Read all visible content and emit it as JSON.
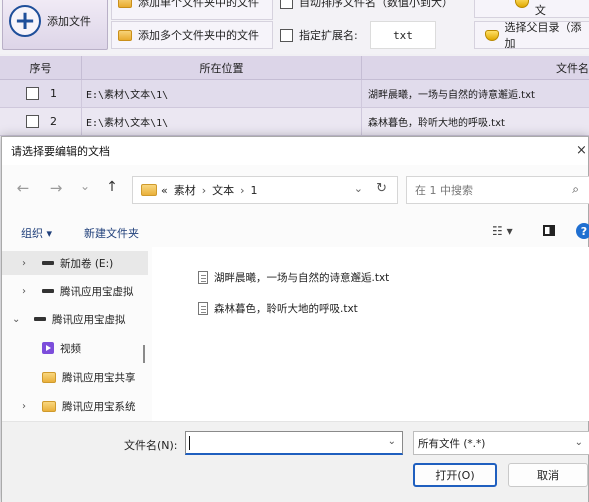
{
  "app": {
    "add_file_label": "添加文件",
    "add_single_folder_label": "添加单个文件夹中的文件",
    "add_multi_folder_label": "添加多个文件夹中的文件",
    "auto_sort_label": "自动排序文件名（数值小到大）",
    "specify_ext_label": "指定扩展名:",
    "ext_value": "txt",
    "add_multi_right_label": "添加多个文",
    "select_parent_label": "选择父目录（添加",
    "table": {
      "headers": [
        "序号",
        "所在位置",
        "文件名"
      ],
      "rows": [
        {
          "index": "1",
          "location": "E:\\素材\\文本\\1\\",
          "filename": "湖畔晨曦，一场与自然的诗意邂逅.txt"
        },
        {
          "index": "2",
          "location": "E:\\素材\\文本\\1\\",
          "filename": "森林暮色，聆听大地的呼吸.txt"
        }
      ]
    }
  },
  "dialog": {
    "title": "请选择要编辑的文档",
    "close_glyph": "×",
    "nav": {
      "back": "←",
      "forward": "→",
      "recent": "⌄",
      "up": "↑",
      "crumb_more": "«",
      "crumbs": [
        "素材",
        "文本",
        "1"
      ],
      "separator": "›",
      "dropdown": "⌄",
      "refresh": "↻"
    },
    "search_placeholder": "在 1 中搜索",
    "organize_label": "组织 ▾",
    "new_folder_label": "新建文件夹",
    "view_icon": "☷ ▾",
    "help_glyph": "?",
    "nav_items": [
      {
        "label": "新加卷 (E:)",
        "chevron": "›",
        "icon": "drive-icon"
      },
      {
        "label": "腾讯应用宝虚拟",
        "chevron": "›",
        "icon": "drive-icon"
      },
      {
        "label": "腾讯应用宝虚拟",
        "chevron": "⌄",
        "icon": "drive-icon"
      },
      {
        "label": "视频",
        "chevron": "",
        "icon": "video-icon"
      },
      {
        "label": "腾讯应用宝共享",
        "chevron": "",
        "icon": "folder-icon"
      },
      {
        "label": "腾讯应用宝系统",
        "chevron": "›",
        "icon": "folder-icon"
      }
    ],
    "files": [
      "湖畔晨曦，一场与自然的诗意邂逅.txt",
      "森林暮色，聆听大地的呼吸.txt"
    ],
    "filename_label": "文件名(N):",
    "filename_value": "",
    "filetype_value": "所有文件 (*.*)",
    "open_label": "打开(O)",
    "cancel_label": "取消"
  }
}
